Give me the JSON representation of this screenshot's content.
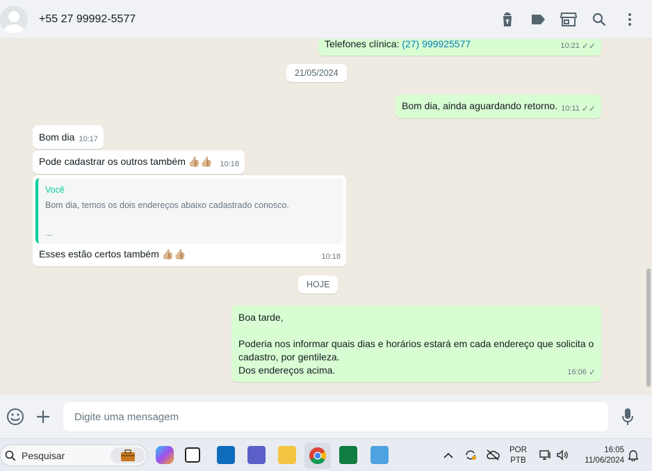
{
  "header": {
    "contact_name": "+55 27 99992-5577",
    "icons": [
      "delete-icon",
      "label-icon",
      "store-icon",
      "search-icon",
      "menu-icon"
    ]
  },
  "messages": {
    "m1": {
      "text": "Telefones clínica: ",
      "link": "(27) 999925577",
      "time": "10:21"
    },
    "date1": "21/05/2024",
    "m2": {
      "text": "Bom dia, ainda aguardando retorno.",
      "time": "10:11"
    },
    "m3": {
      "text": "Bom dia",
      "time": "10:17"
    },
    "m4": {
      "text": "Pode cadastrar os outros também 👍🏼👍🏼",
      "time": "10:18"
    },
    "m5": {
      "quote_author": "Você",
      "quote_text": "Bom dia, temos os dois endereços abaixo cadastrado conosco.",
      "quote_ellipsis": "...",
      "text": "Esses estão certos também 👍🏼👍🏼",
      "time": "10:18"
    },
    "date2": "HOJE",
    "m6": {
      "line1": "Boa tarde,",
      "line2": "Poderia nos informar quais dias e horários estará em cada endereço que solicita o",
      "line3": "cadastro, por gentileza.",
      "line4": "Dos endereços acima.",
      "time": "16:06"
    }
  },
  "composer": {
    "placeholder": "Digite uma mensagem"
  },
  "taskbar": {
    "search_label": "Pesquisar",
    "lang_line1": "POR",
    "lang_line2": "PTB",
    "time": "16:05",
    "date": "11/06/2024"
  },
  "colors": {
    "outgoing_bubble": "#d9fdd3",
    "incoming_bubble": "#ffffff",
    "accent": "#06cf9c",
    "link": "#027eb5"
  }
}
